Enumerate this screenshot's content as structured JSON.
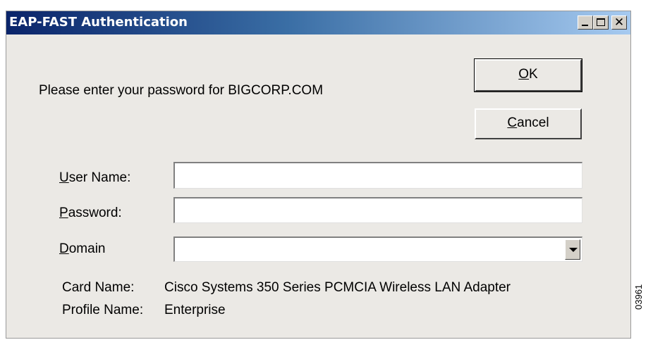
{
  "window": {
    "title": "EAP-FAST Authentication",
    "minimize_icon": "minimize-icon",
    "maximize_icon": "maximize-icon",
    "close_glyph": "✕"
  },
  "prompt": "Please enter your password for BIGCORP.COM",
  "buttons": {
    "ok": {
      "accel": "O",
      "rest": "K"
    },
    "cancel": {
      "accel": "C",
      "rest": "ancel"
    }
  },
  "fields": {
    "user_name": {
      "accel": "U",
      "rest": "ser Name:",
      "value": ""
    },
    "password": {
      "accel": "P",
      "rest": "assword:",
      "value": ""
    },
    "domain": {
      "accel": "D",
      "rest": "omain",
      "value": ""
    }
  },
  "info": {
    "card_name_label": "Card Name:",
    "card_name_value": "Cisco Systems 350 Series PCMCIA Wireless LAN Adapter",
    "profile_name_label": "Profile Name:",
    "profile_name_value": "Enterprise"
  },
  "figure_code": "03961"
}
